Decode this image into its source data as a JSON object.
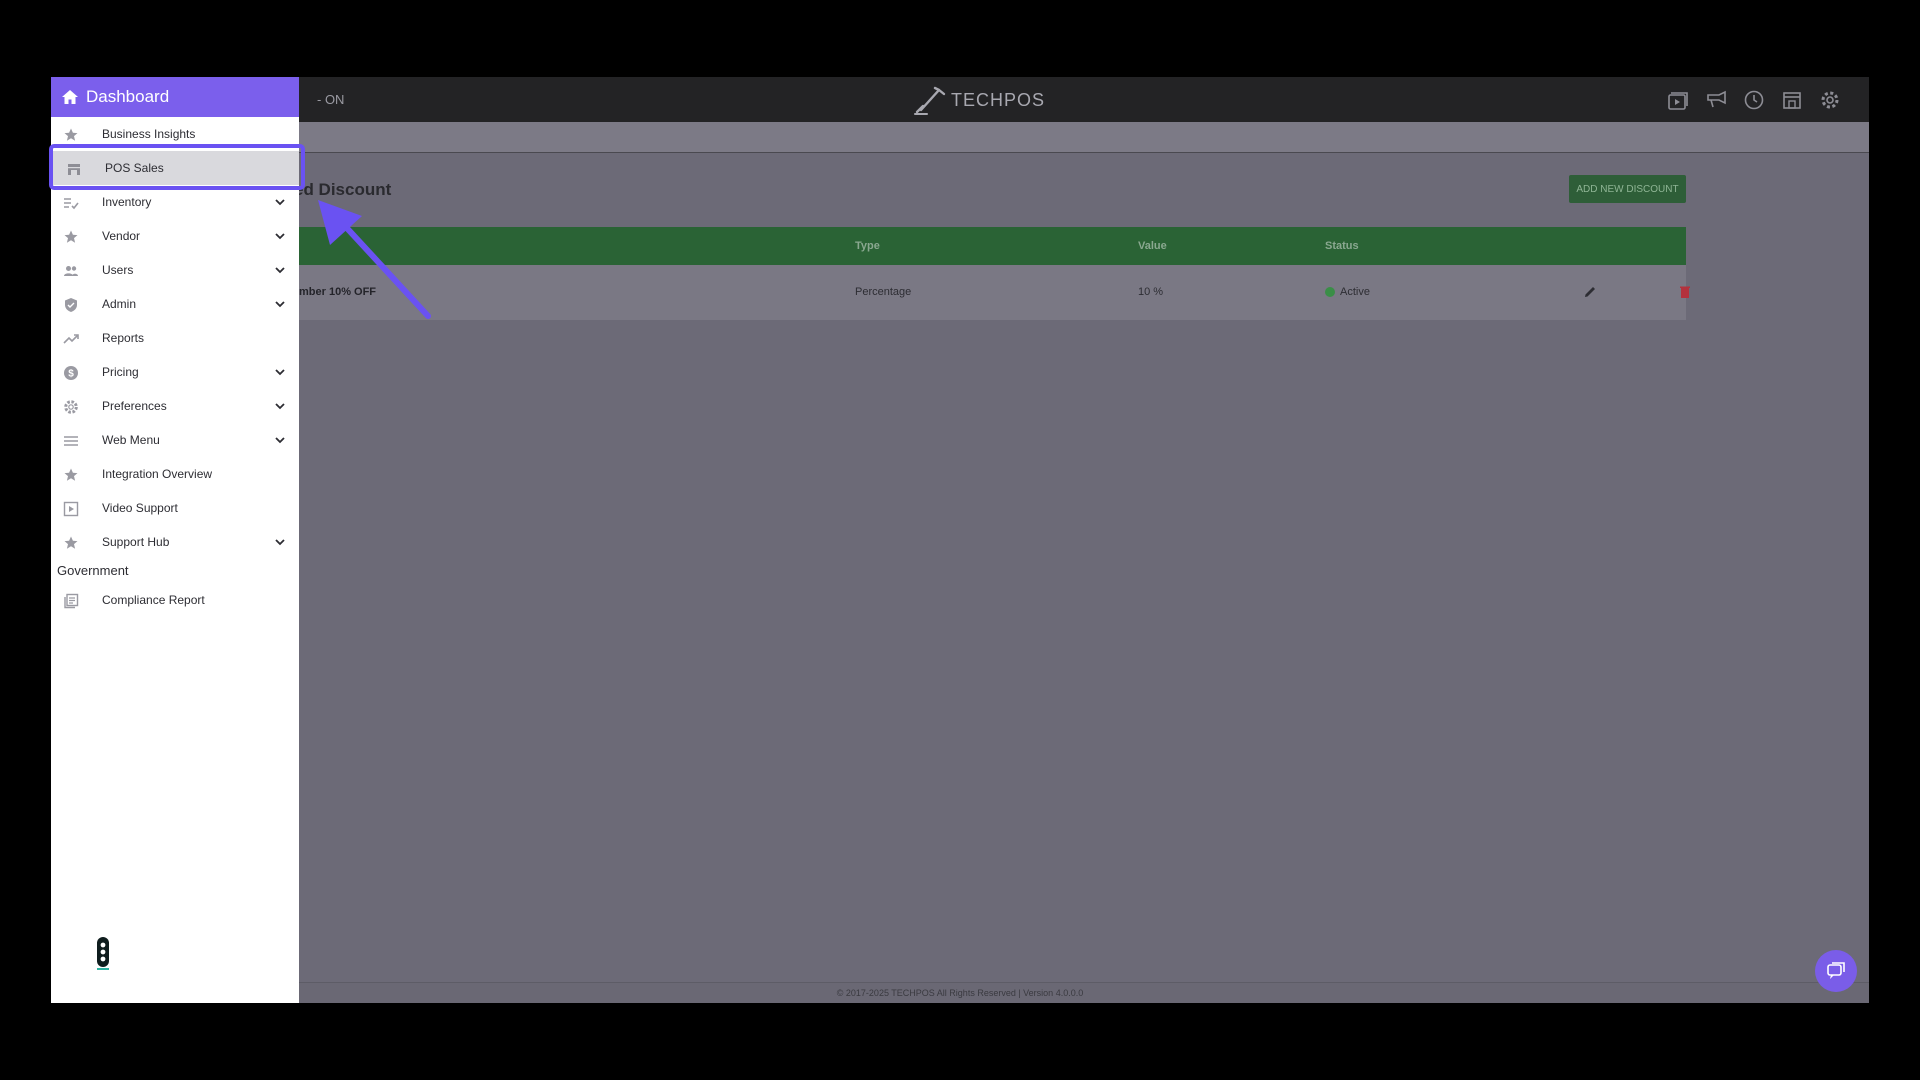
{
  "header": {
    "status_text": "- ON",
    "logo_text": "TECHPOS",
    "icons": [
      "video-library-icon",
      "megaphone-icon",
      "clock-icon",
      "storefront-icon",
      "gear-icon"
    ]
  },
  "main": {
    "page_title": "ed Discount",
    "add_button": "ADD NEW DISCOUNT",
    "table": {
      "columns": [
        "Type",
        "Value",
        "Status"
      ],
      "rows": [
        {
          "name": "mber 10% OFF",
          "type": "Percentage",
          "value": "10 %",
          "status": "Active"
        }
      ]
    }
  },
  "footer": {
    "text": "© 2017-2025 TECHPOS All Rights Reserved | Version 4.0.0.0"
  },
  "sidebar": {
    "header_label": "Dashboard",
    "items": [
      {
        "label": "Business Insights",
        "icon": "star-icon"
      },
      {
        "label": "POS Sales",
        "icon": "storefront-icon"
      },
      {
        "label": "Inventory",
        "icon": "checklist-icon"
      },
      {
        "label": "Vendor",
        "icon": "star-icon"
      },
      {
        "label": "Users",
        "icon": "users-icon"
      },
      {
        "label": "Admin",
        "icon": "shield-icon"
      },
      {
        "label": "Reports",
        "icon": "trend-icon"
      },
      {
        "label": "Pricing",
        "icon": "dollar-icon"
      },
      {
        "label": "Preferences",
        "icon": "gear-icon"
      },
      {
        "label": "Web Menu",
        "icon": "menu-icon"
      },
      {
        "label": "Integration Overview",
        "icon": "star-icon"
      },
      {
        "label": "Video Support",
        "icon": "play-icon"
      },
      {
        "label": "Support Hub",
        "icon": "star-icon"
      }
    ],
    "section_label": "Government",
    "section_items": [
      {
        "label": "Compliance Report",
        "icon": "report-icon"
      }
    ]
  },
  "colors": {
    "accent": "#7b5fec",
    "highlight": "#6a52f2",
    "table_header": "#2a6335",
    "status_active": "#3a8e47"
  }
}
